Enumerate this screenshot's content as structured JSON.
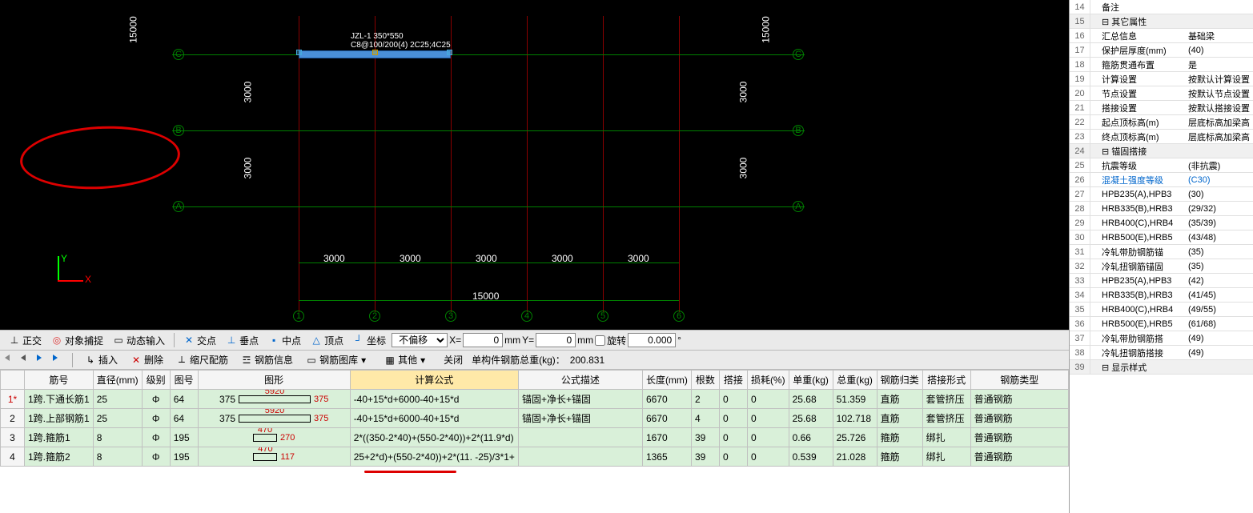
{
  "canvas": {
    "beam_label": "JZL-1 350*550\nC8@100/200(4) 2C25;4C25",
    "row_labels": [
      "C",
      "B",
      "A"
    ],
    "col_labels": [
      "1",
      "2",
      "3",
      "4",
      "5",
      "6"
    ],
    "h_span": "3000",
    "h_total": "15000",
    "v_span": "3000",
    "v_total": "15000",
    "ucs": {
      "x": "X",
      "y": "Y"
    }
  },
  "tb": {
    "ortho": "正交",
    "snap": "对象捕捉",
    "dyn": "动态输入",
    "cross": "交点",
    "perp": "垂点",
    "mid": "中点",
    "apex": "顶点",
    "foot": "坐标",
    "offset": "不偏移",
    "x": "X=",
    "xval": "0",
    "xunit": "mm",
    "y": "Y=",
    "yval": "0",
    "yunit": "mm",
    "rot": "旋转",
    "rotval": "0.000",
    "rotunit": "°"
  },
  "tb2": {
    "insert": "插入",
    "delete": "删除",
    "scale": "缩尺配筋",
    "info": "钢筋信息",
    "lib": "钢筋图库",
    "other": "其他",
    "close": "关闭",
    "weight_lbl": "单构件钢筋总重(kg)：",
    "weight_val": "200.831"
  },
  "cols": {
    "c0": "",
    "c1": "筋号",
    "c2": "直径(mm)",
    "c3": "级别",
    "c4": "图号",
    "c5": "图形",
    "c6": "计算公式",
    "c7": "公式描述",
    "c8": "长度(mm)",
    "c9": "根数",
    "c10": "搭接",
    "c11": "损耗(%)",
    "c12": "单重(kg)",
    "c13": "总重(kg)",
    "c14": "钢筋归类",
    "c15": "搭接形式",
    "c16": "钢筋类型"
  },
  "rows": [
    {
      "n": "1*",
      "name": "1跨.下通长筋1",
      "d": "25",
      "g": "Φ",
      "code": "64",
      "s_l": "375",
      "s_m": "5920",
      "s_r": "375",
      "calc": "-40+15*d+6000-40+15*d",
      "desc": "锚固+净长+锚固",
      "len": "6670",
      "cnt": "2",
      "lap": "0",
      "loss": "0",
      "uw": "25.68",
      "tw": "51.359",
      "cat": "直筋",
      "lapf": "套管挤压",
      "type": "普通钢筋"
    },
    {
      "n": "2",
      "name": "1跨.上部钢筋1",
      "d": "25",
      "g": "Φ",
      "code": "64",
      "s_l": "375",
      "s_m": "5920",
      "s_r": "375",
      "calc": "-40+15*d+6000-40+15*d",
      "desc": "锚固+净长+锚固",
      "len": "6670",
      "cnt": "4",
      "lap": "0",
      "loss": "0",
      "uw": "25.68",
      "tw": "102.718",
      "cat": "直筋",
      "lapf": "套管挤压",
      "type": "普通钢筋"
    },
    {
      "n": "3",
      "name": "1跨.箍筋1",
      "d": "8",
      "g": "Φ",
      "code": "195",
      "s_l": "",
      "s_m": "470",
      "s_r": "270",
      "calc": "2*((350-2*40)+(550-2*40))+2*(11.9*d)",
      "desc": "",
      "len": "1670",
      "cnt": "39",
      "lap": "0",
      "loss": "0",
      "uw": "0.66",
      "tw": "25.726",
      "cat": "箍筋",
      "lapf": "绑扎",
      "type": "普通钢筋"
    },
    {
      "n": "4",
      "name": "1跨.箍筋2",
      "d": "8",
      "g": "Φ",
      "code": "195",
      "s_l": "",
      "s_m": "470",
      "s_r": "117",
      "calc": "25+2*d)+(550-2*40))+2*(11. -25)/3*1+",
      "desc": "",
      "len": "1365",
      "cnt": "39",
      "lap": "0",
      "loss": "0",
      "uw": "0.539",
      "tw": "21.028",
      "cat": "箍筋",
      "lapf": "绑扎",
      "type": "普通钢筋"
    }
  ],
  "props": [
    {
      "n": "14",
      "name": "备注",
      "val": ""
    },
    {
      "n": "15",
      "name": "其它属性",
      "val": "",
      "group": true
    },
    {
      "n": "16",
      "name": "汇总信息",
      "val": "基础梁"
    },
    {
      "n": "17",
      "name": "保护层厚度(mm)",
      "val": "(40)"
    },
    {
      "n": "18",
      "name": "箍筋贯通布置",
      "val": "是"
    },
    {
      "n": "19",
      "name": "计算设置",
      "val": "按默认计算设置"
    },
    {
      "n": "20",
      "name": "节点设置",
      "val": "按默认节点设置"
    },
    {
      "n": "21",
      "name": "搭接设置",
      "val": "按默认搭接设置"
    },
    {
      "n": "22",
      "name": "起点顶标高(m)",
      "val": "层底标高加梁高"
    },
    {
      "n": "23",
      "name": "终点顶标高(m)",
      "val": "层底标高加梁高"
    },
    {
      "n": "24",
      "name": "锚固搭接",
      "val": "",
      "group": true
    },
    {
      "n": "25",
      "name": "抗震等级",
      "val": "(非抗震)"
    },
    {
      "n": "26",
      "name": "混凝土强度等级",
      "val": "(C30)",
      "hl": true
    },
    {
      "n": "27",
      "name": "HPB235(A),HPB3",
      "val": "(30)"
    },
    {
      "n": "28",
      "name": "HRB335(B),HRB3",
      "val": "(29/32)"
    },
    {
      "n": "29",
      "name": "HRB400(C),HRB4",
      "val": "(35/39)"
    },
    {
      "n": "30",
      "name": "HRB500(E),HRB5",
      "val": "(43/48)"
    },
    {
      "n": "31",
      "name": "冷轧带肋钢筋锚",
      "val": "(35)"
    },
    {
      "n": "32",
      "name": "冷轧扭钢筋锚固",
      "val": "(35)"
    },
    {
      "n": "33",
      "name": "HPB235(A),HPB3",
      "val": "(42)"
    },
    {
      "n": "34",
      "name": "HRB335(B),HRB3",
      "val": "(41/45)"
    },
    {
      "n": "35",
      "name": "HRB400(C),HRB4",
      "val": "(49/55)"
    },
    {
      "n": "36",
      "name": "HRB500(E),HRB5",
      "val": "(61/68)"
    },
    {
      "n": "37",
      "name": "冷轧带肋钢筋搭",
      "val": "(49)"
    },
    {
      "n": "38",
      "name": "冷轧扭钢筋搭接",
      "val": "(49)"
    },
    {
      "n": "39",
      "name": "显示样式",
      "val": "",
      "group": true
    }
  ]
}
